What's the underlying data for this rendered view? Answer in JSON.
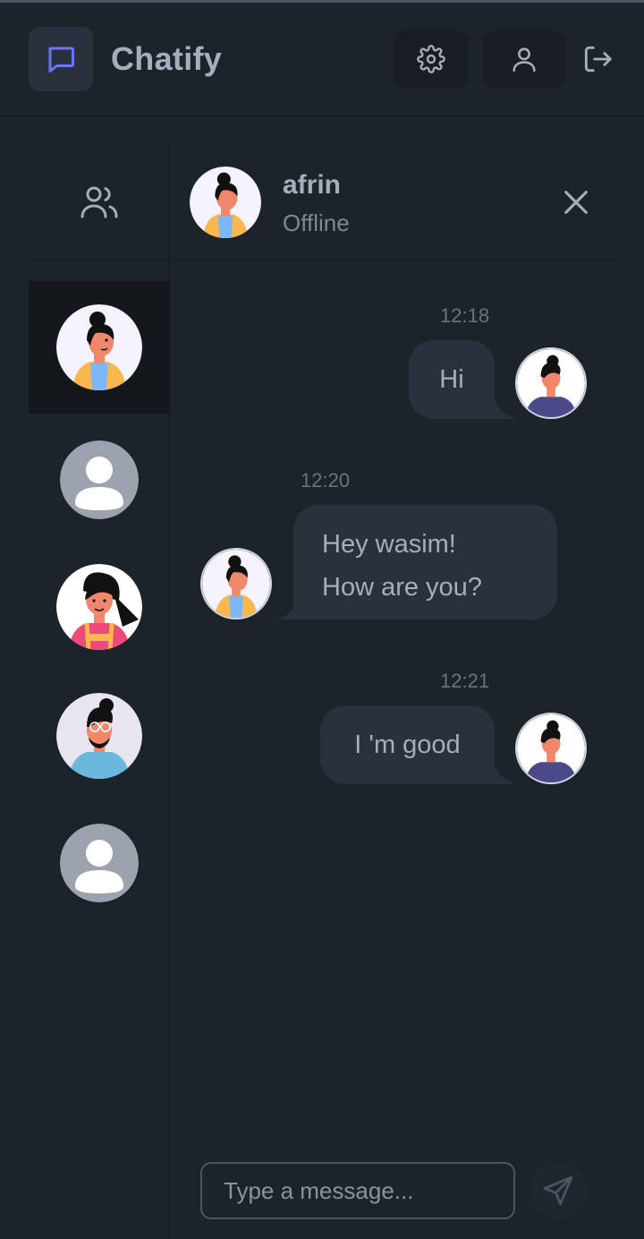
{
  "app": {
    "title": "Chatify"
  },
  "navbar": {
    "brand_icon": "chat-bubble-icon",
    "settings_icon": "gear-icon",
    "profile_icon": "user-icon",
    "logout_icon": "logout-icon"
  },
  "sidebar": {
    "header_icon": "users-icon",
    "contacts": [
      {
        "avatar": "woman-bun-yellow-avatar",
        "active": true
      },
      {
        "avatar": "default-user-avatar",
        "active": false
      },
      {
        "avatar": "woman-pink-apron-avatar",
        "active": false
      },
      {
        "avatar": "man-glasses-blue-avatar",
        "active": false
      },
      {
        "avatar": "default-user-avatar",
        "active": false
      }
    ]
  },
  "chat": {
    "contact_name": "afrin",
    "contact_status": "Offline",
    "close_icon": "close-icon",
    "messages": [
      {
        "time": "12:18",
        "lines": [
          "Hi"
        ],
        "side": "right"
      },
      {
        "time": "12:20",
        "lines": [
          "Hey wasim!",
          "How are you?"
        ],
        "side": "left"
      },
      {
        "time": "12:21",
        "lines": [
          "I 'm good"
        ],
        "side": "right"
      }
    ]
  },
  "composer": {
    "placeholder": "Type a message...",
    "send_icon": "send-icon"
  },
  "colors": {
    "background": "#1d232a",
    "bubble": "#2a303c",
    "brand_accent": "#6d75f6",
    "active_contact": "#14181d"
  }
}
